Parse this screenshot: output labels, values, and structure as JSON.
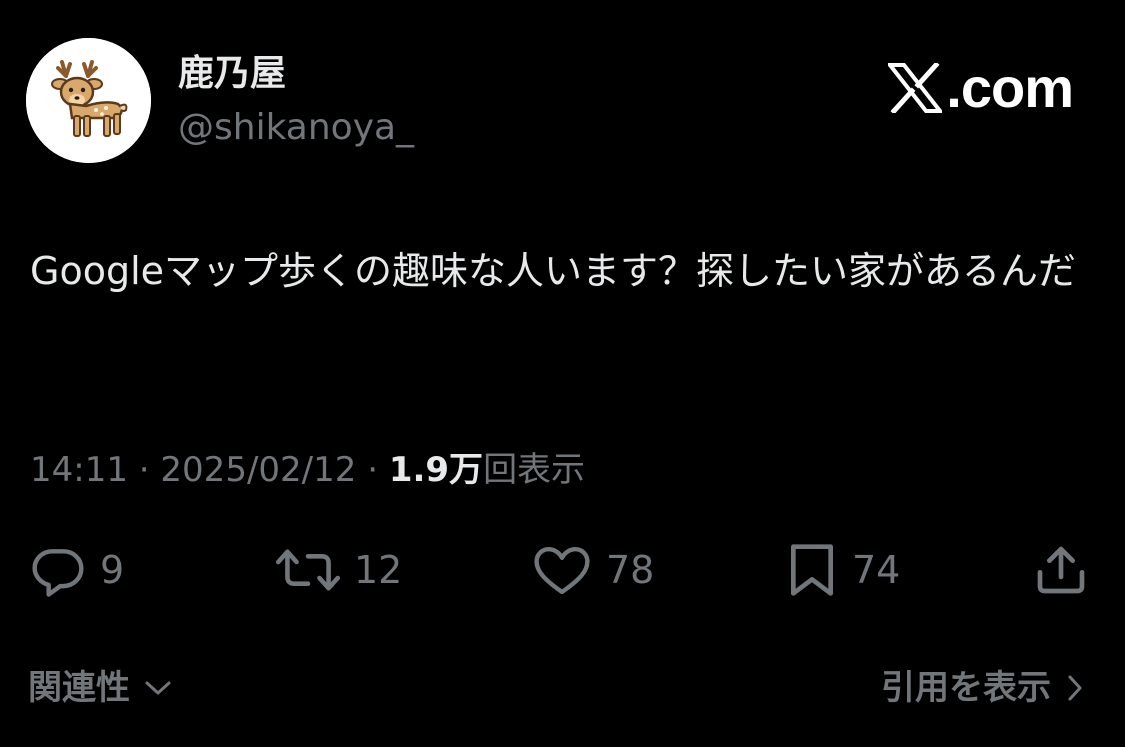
{
  "header": {
    "display_name": "鹿乃屋",
    "handle": "@shikanoya_",
    "brand_text": ".com",
    "brand_icon": "x-logo-icon",
    "avatar_icon": "deer-avatar-icon"
  },
  "tweet": {
    "text": "Googleマップ歩くの趣味な人います？探したい家があるんだ"
  },
  "meta": {
    "time": "14:11",
    "separator": "·",
    "date": "2025/02/12",
    "views_count": "1.9万",
    "views_label": "回表示"
  },
  "actions": {
    "reply": {
      "icon": "reply-bubble-icon",
      "count": "9"
    },
    "repost": {
      "icon": "repost-icon",
      "count": "12"
    },
    "like": {
      "icon": "heart-icon",
      "count": "78"
    },
    "bookmark": {
      "icon": "bookmark-icon",
      "count": "74"
    },
    "share": {
      "icon": "share-icon"
    }
  },
  "footer": {
    "relevance_label": "関連性",
    "quotes_label": "引用を表示"
  },
  "colors": {
    "background": "#000000",
    "primary_text": "#e7e9ea",
    "secondary_text": "#71767b",
    "avatar_bg": "#ffffff",
    "deer_body": "#d9a86c"
  }
}
